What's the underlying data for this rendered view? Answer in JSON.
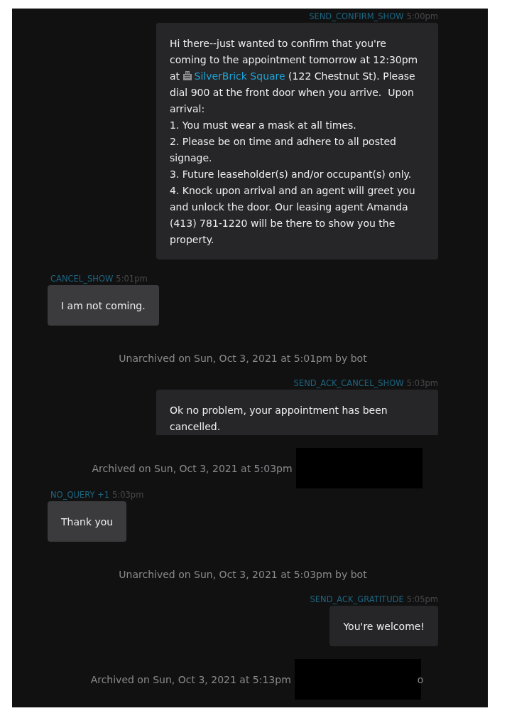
{
  "items": [
    {
      "kind": "sent",
      "tag": "SEND_CONFIRM_SHOW",
      "time": "5:00pm",
      "clipped": false,
      "parts": [
        {
          "kind": "text",
          "text": "Hi there--just wanted to confirm that you're coming to the appointment tomorrow at 12:30pm at "
        },
        {
          "kind": "link",
          "text": "SilverBrick Square"
        },
        {
          "kind": "text",
          "text": " (122 Chestnut St). Please dial 900 at the front door when you arrive.  Upon arrival:\n1. You must wear a mask at all times.\n2. Please be on time and adhere to all posted signage.\n3. Future leaseholder(s) and/or occupant(s) only.\n4. Knock upon arrival and an agent will greet you and unlock the door. Our leasing agent Amanda (413) 781-1220 will be there to show you the property."
        }
      ]
    },
    {
      "kind": "received",
      "tag": "CANCEL_SHOW",
      "time": "5:01pm",
      "clipped": false,
      "parts": [
        {
          "kind": "text",
          "text": "I am not coming."
        }
      ]
    },
    {
      "kind": "event",
      "text": "Unarchived on Sun, Oct 3, 2021 at 5:01pm by bot",
      "redacted": false
    },
    {
      "kind": "sent",
      "tag": "SEND_ACK_CANCEL_SHOW",
      "time": "5:03pm",
      "clipped": true,
      "parts": [
        {
          "kind": "text",
          "text": "Ok no problem, your appointment has been cancelled."
        }
      ]
    },
    {
      "kind": "event",
      "text": "Archived on Sun, Oct 3, 2021 at 5:03pm",
      "redacted": true
    },
    {
      "kind": "received",
      "tag": "NO_QUERY +1",
      "time": "5:03pm",
      "clipped": false,
      "parts": [
        {
          "kind": "text",
          "text": "Thank you"
        }
      ]
    },
    {
      "kind": "event",
      "text": "Unarchived on Sun, Oct 3, 2021 at 5:03pm by bot",
      "redacted": false
    },
    {
      "kind": "sent",
      "tag": "SEND_ACK_GRATITUDE",
      "time": "5:05pm",
      "clipped": false,
      "parts": [
        {
          "kind": "text",
          "text": "You're welcome!"
        }
      ]
    },
    {
      "kind": "event",
      "text": "Archived on Sun, Oct 3, 2021 at 5:13pm",
      "redacted": true,
      "tail": "o"
    }
  ]
}
